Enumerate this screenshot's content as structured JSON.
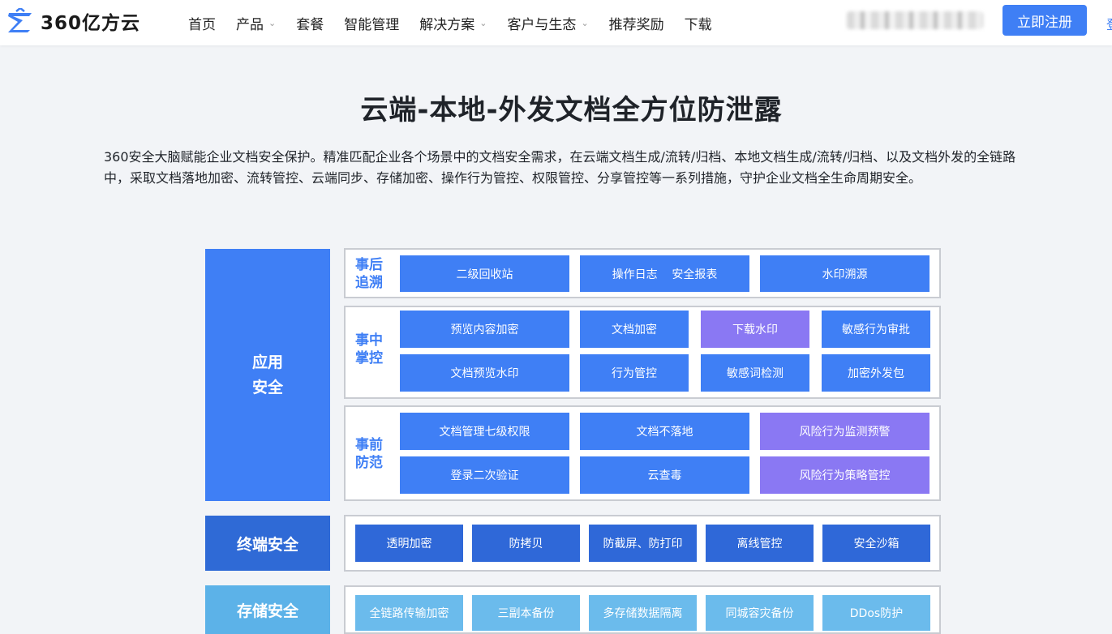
{
  "nav": {
    "logo_text": "360亿方云",
    "menu": [
      {
        "label": "首页",
        "dropdown": false
      },
      {
        "label": "产品",
        "dropdown": true
      },
      {
        "label": "套餐",
        "dropdown": false
      },
      {
        "label": "智能管理",
        "dropdown": false
      },
      {
        "label": "解决方案",
        "dropdown": true
      },
      {
        "label": "客户与生态",
        "dropdown": true
      },
      {
        "label": "推荐奖励",
        "dropdown": false
      },
      {
        "label": "下载",
        "dropdown": false
      }
    ],
    "chevron": "⌄",
    "register_label": "立即注册",
    "edge_char": "登"
  },
  "main": {
    "title": "云端-本地-外发文档全方位防泄露",
    "description": "360安全大脑赋能企业文档安全保护。精准匹配企业各个场景中的文档安全需求，在云端文档生成/流转/归档、本地文档生成/流转/归档、以及文档外发的全链路中，采取文档落地加密、流转管控、云端同步、存储加密、操作行为管控、权限管控、分享管控等一系列措施，守护企业文档全生命周期安全。"
  },
  "diagram": {
    "app_security": {
      "label_line1": "应用",
      "label_line2": "安全",
      "after": {
        "line1": "事后",
        "line2": "追溯",
        "items": [
          "二级回收站",
          "操作日志    安全报表",
          "水印溯源"
        ]
      },
      "during": {
        "line1": "事中",
        "line2": "掌控",
        "items": [
          "预览内容加密",
          "文档加密",
          "下载水印",
          "敏感行为审批",
          "文档预览水印",
          "行为管控",
          "敏感词检测",
          "加密外发包"
        ]
      },
      "before": {
        "line1": "事前",
        "line2": "防范",
        "items": [
          "文档管理七级权限",
          "文档不落地",
          "风险行为监测预警",
          "登录二次验证",
          "云查毒",
          "风险行为策略管控"
        ]
      }
    },
    "terminal_security": {
      "label": "终端安全",
      "items": [
        "透明加密",
        "防拷贝",
        "防截屏、防打印",
        "离线管控",
        "安全沙箱"
      ]
    },
    "storage_security": {
      "label": "存储安全",
      "items": [
        "全链路传输加密",
        "三副本备份",
        "多存储数据隔离",
        "同城容灾备份",
        "DDos防护"
      ]
    }
  },
  "colors": {
    "primary": "#3f7ff5",
    "purple": "#8a78f3",
    "terminal": "#2f68d8",
    "storage": "#6bbbec"
  }
}
